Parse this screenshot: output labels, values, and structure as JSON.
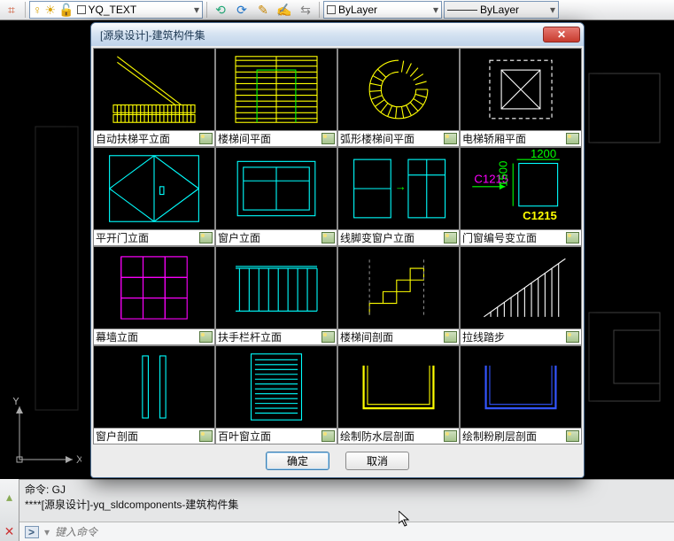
{
  "toolbar": {
    "layer_name": "YQ_TEXT",
    "prop1": "ByLayer",
    "prop2": "ByLayer"
  },
  "dialog": {
    "title": "[源泉设计]-建筑构件集",
    "ok": "确定",
    "cancel": "取消",
    "items": [
      "自动扶梯平立面",
      "楼梯间平面",
      "弧形楼梯间平面",
      "电梯轿厢平面",
      "平开门立面",
      "窗户立面",
      "线脚变窗户立面",
      "门窗编号变立面",
      "幕墙立面",
      "扶手栏杆立面",
      "楼梯间剖面",
      "拉线踏步",
      "窗户剖面",
      "百叶窗立面",
      "绘制防水层剖面",
      "绘制粉刷层剖面"
    ],
    "c1215_label": "C1215",
    "c1215_w": "1200",
    "c1215_h": "1500"
  },
  "cmd": {
    "line1": "命令: GJ",
    "line2": "****[源泉设计]-yq_sldcomponents-建筑构件集",
    "placeholder": "键入命令"
  },
  "ucs": {
    "x": "X",
    "y": "Y"
  }
}
